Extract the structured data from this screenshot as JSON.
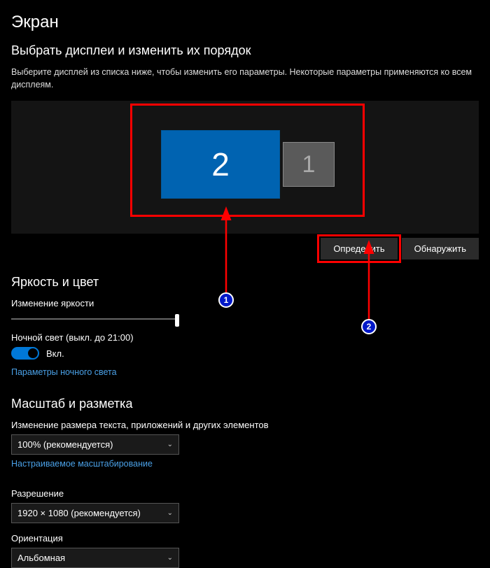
{
  "page": {
    "title": "Экран"
  },
  "rearrange": {
    "heading": "Выбрать дисплеи и изменить их порядок",
    "description": "Выберите дисплей из списка ниже, чтобы изменить его параметры. Некоторые параметры применяются ко всем дисплеям.",
    "monitor_primary": "2",
    "monitor_secondary": "1",
    "identify_button": "Определить",
    "detect_button": "Обнаружить"
  },
  "brightness": {
    "heading": "Яркость и цвет",
    "slider_label": "Изменение яркости",
    "night_light_label": "Ночной свет (выкл. до 21:00)",
    "toggle_state": "Вкл.",
    "night_light_link": "Параметры ночного света"
  },
  "scale": {
    "heading": "Масштаб и разметка",
    "text_scale_label": "Изменение размера текста, приложений и других элементов",
    "text_scale_value": "100% (рекомендуется)",
    "custom_scaling_link": "Настраиваемое масштабирование",
    "resolution_label": "Разрешение",
    "resolution_value": "1920 × 1080 (рекомендуется)",
    "orientation_label": "Ориентация",
    "orientation_value": "Альбомная"
  },
  "annotations": {
    "badge1": "1",
    "badge2": "2"
  }
}
